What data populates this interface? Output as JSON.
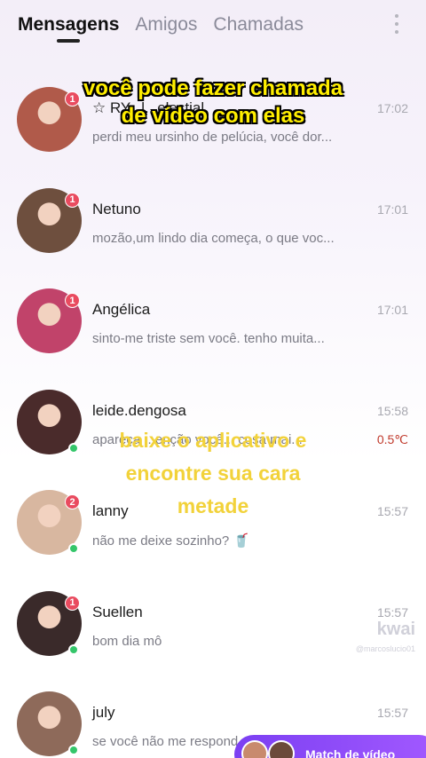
{
  "tabs": [
    {
      "label": "Mensagens",
      "active": true
    },
    {
      "label": "Amigos",
      "active": false
    },
    {
      "label": "Chamadas",
      "active": false
    }
  ],
  "menu_icon": "more-vertical-icon",
  "conversations": [
    {
      "name": "☆ RY...l...elestial",
      "time": "17:02",
      "preview": "perdi meu ursinho de pelúcia, você dor...",
      "unread": "1",
      "online": false,
      "avatar_color": "#b05a4a"
    },
    {
      "name": "Netuno",
      "time": "17:01",
      "preview": "mozão,um lindo dia começa, o que voc...",
      "unread": "1",
      "online": false,
      "avatar_color": "#6e4f3e"
    },
    {
      "name": "Angélica",
      "time": "17:01",
      "preview": "sinto-me triste sem você. tenho muita...",
      "unread": "1",
      "online": false,
      "avatar_color": "#c1436a"
    },
    {
      "name": "leide.dengosa",
      "time": "15:58",
      "preview": "apareça ...enção você... cosa mai...",
      "temp": "0.5℃",
      "unread": "",
      "online": true,
      "avatar_color": "#4a2b2b"
    },
    {
      "name": "lanny",
      "time": "15:57",
      "preview": "não me deixe sozinho? 🥤",
      "unread": "2",
      "online": true,
      "avatar_color": "#d8b7a0"
    },
    {
      "name": "Suellen",
      "time": "15:57",
      "preview": "bom dia mô",
      "unread": "1",
      "online": true,
      "avatar_color": "#3a2a2a"
    },
    {
      "name": "july",
      "time": "15:57",
      "preview": "se você não me respond...",
      "unread": "",
      "online": true,
      "avatar_color": "#8e6a5a"
    }
  ],
  "overlay_top": [
    "você pode fazer chamada",
    "de vídeo com elas"
  ],
  "overlay_mid": [
    "baixe o aplicativo e",
    "encontre sua cara",
    "metade"
  ],
  "watermark": {
    "brand": "kwai",
    "handle": "@marcoslucio01"
  },
  "match_button": {
    "label": "Match de vídeo"
  },
  "colors": {
    "badge": "#e94b5f",
    "online": "#34c66a",
    "overlay_text": "#ffee00",
    "match_bg": "#8a4bf7"
  }
}
